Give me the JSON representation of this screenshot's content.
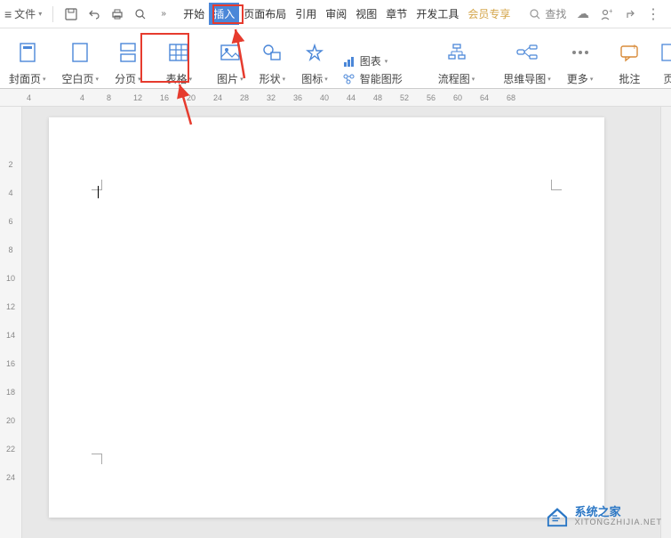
{
  "menubar": {
    "file_label": "文件",
    "tabs": {
      "start": "开始",
      "insert": "插入",
      "layout": "页面布局",
      "reference": "引用",
      "review": "审阅",
      "view": "视图",
      "chapter": "章节",
      "devtools": "开发工具",
      "vip": "会员专享"
    },
    "search_placeholder": "查找"
  },
  "ribbon": {
    "cover": "封面页",
    "blank": "空白页",
    "pagebreak": "分页",
    "table": "表格",
    "picture": "图片",
    "shape": "形状",
    "icon": "图标",
    "chart": "图表",
    "smartart": "智能图形",
    "flowchart": "流程图",
    "mindmap": "思维导图",
    "more": "更多",
    "comment": "批注",
    "pagenum_partial": "页"
  },
  "ruler_h": [
    "4",
    "",
    "4",
    "8",
    "12",
    "16",
    "20",
    "24",
    "28",
    "32",
    "36",
    "40",
    "44",
    "48",
    "52",
    "56",
    "60",
    "64",
    "68"
  ],
  "ruler_v": [
    "2",
    "4",
    "6",
    "8",
    "10",
    "12",
    "14",
    "16",
    "18",
    "20",
    "22",
    "24"
  ],
  "watermark": {
    "title": "系统之家",
    "subtitle": "XITONGZHIJIA.NET"
  }
}
